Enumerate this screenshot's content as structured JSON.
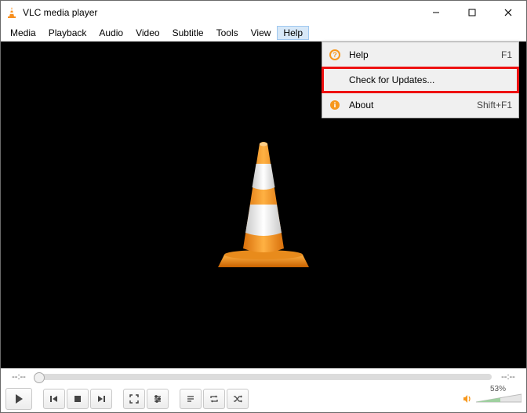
{
  "window": {
    "title": "VLC media player"
  },
  "menubar": {
    "items": [
      "Media",
      "Playback",
      "Audio",
      "Video",
      "Subtitle",
      "Tools",
      "View",
      "Help"
    ],
    "active_index": 7
  },
  "help_menu": {
    "items": [
      {
        "icon": "help-circle",
        "label": "Help",
        "shortcut": "F1"
      },
      {
        "icon": "",
        "label": "Check for Updates...",
        "shortcut": "",
        "highlight": true
      },
      {
        "icon": "info-circle",
        "label": "About",
        "shortcut": "Shift+F1"
      }
    ]
  },
  "player": {
    "time_elapsed": "--:--",
    "time_total": "--:--",
    "volume_pct": "53%"
  },
  "icons": {
    "play": "play-icon",
    "prev": "skip-back-icon",
    "stop": "stop-icon",
    "next": "skip-forward-icon",
    "fullscreen": "fullscreen-icon",
    "extended": "extended-settings-icon",
    "playlist": "playlist-icon",
    "loop": "loop-icon",
    "shuffle": "shuffle-icon",
    "speaker": "speaker-icon"
  }
}
